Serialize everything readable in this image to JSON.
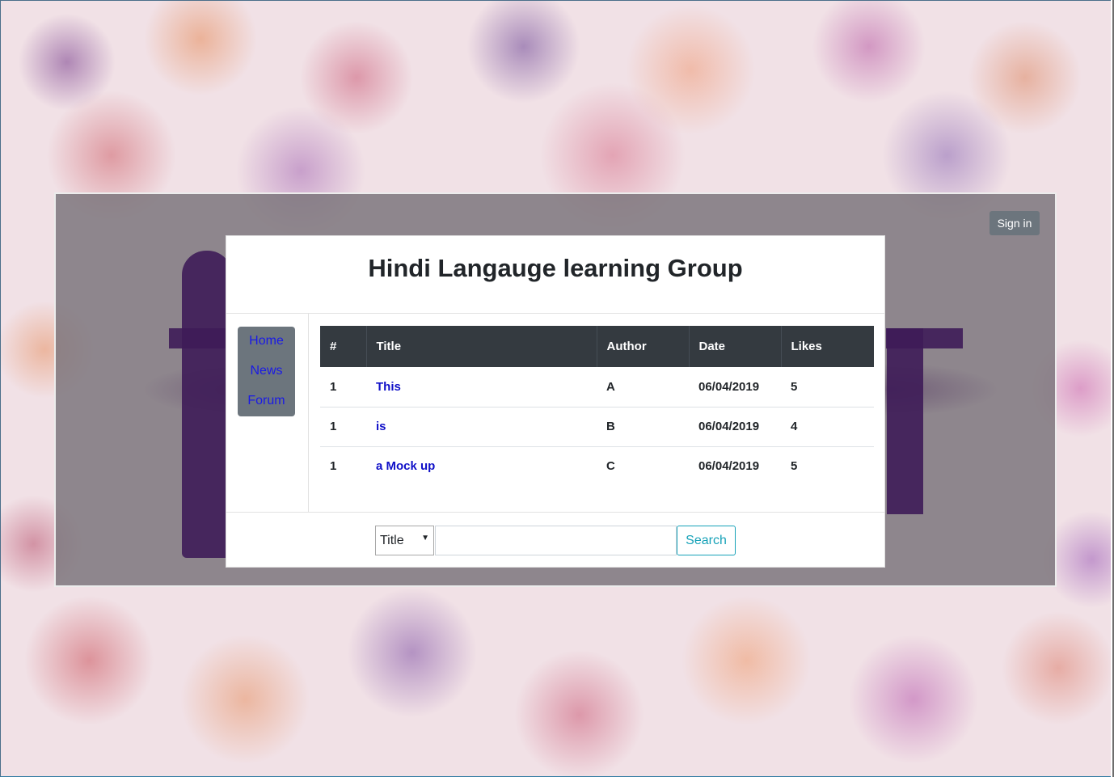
{
  "header": {
    "signin_label": "Sign in"
  },
  "card": {
    "title": "Hindi Langauge learning Group"
  },
  "sidebar": {
    "items": [
      {
        "label": "Home"
      },
      {
        "label": "News"
      },
      {
        "label": "Forum"
      }
    ]
  },
  "table": {
    "columns": [
      "#",
      "Title",
      "Author",
      "Date",
      "Likes"
    ],
    "rows": [
      {
        "num": "1",
        "title": "This",
        "author": "A",
        "date": "06/04/2019",
        "likes": "5"
      },
      {
        "num": "1",
        "title": "is",
        "author": "B",
        "date": "06/04/2019",
        "likes": "4"
      },
      {
        "num": "1",
        "title": "a Mock up",
        "author": "C",
        "date": "06/04/2019",
        "likes": "5"
      }
    ]
  },
  "search": {
    "field_selected": "Title",
    "query_value": "",
    "button_label": "Search"
  },
  "colors": {
    "header_dark": "#343a40",
    "nav_bg": "#6c757d",
    "link": "#1010c8",
    "search_accent": "#17a2b8"
  },
  "icons": {
    "select_caret": "caret-down-icon"
  }
}
